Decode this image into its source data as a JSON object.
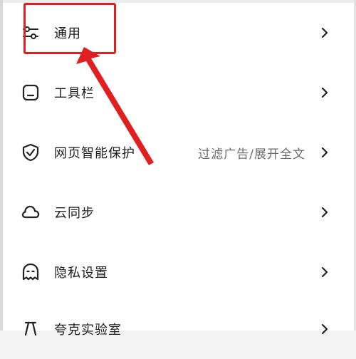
{
  "menu": {
    "items": [
      {
        "label": "通用",
        "hint": "",
        "icon": "sliders-icon"
      },
      {
        "label": "工具栏",
        "hint": "",
        "icon": "toolbar-icon"
      },
      {
        "label": "网页智能保护",
        "hint": "过滤广告/展开全文",
        "icon": "shield-check-icon"
      },
      {
        "label": "云同步",
        "hint": "",
        "icon": "cloud-icon"
      },
      {
        "label": "隐私设置",
        "hint": "",
        "icon": "privacy-mask-icon"
      },
      {
        "label": "夸克实验室",
        "hint": "",
        "icon": "lab-icon"
      }
    ]
  },
  "annotation": {
    "color": "#e02020"
  },
  "colors": {
    "text": "#1e1e1e",
    "hint": "#6b6b6b",
    "icon": "#222222"
  }
}
